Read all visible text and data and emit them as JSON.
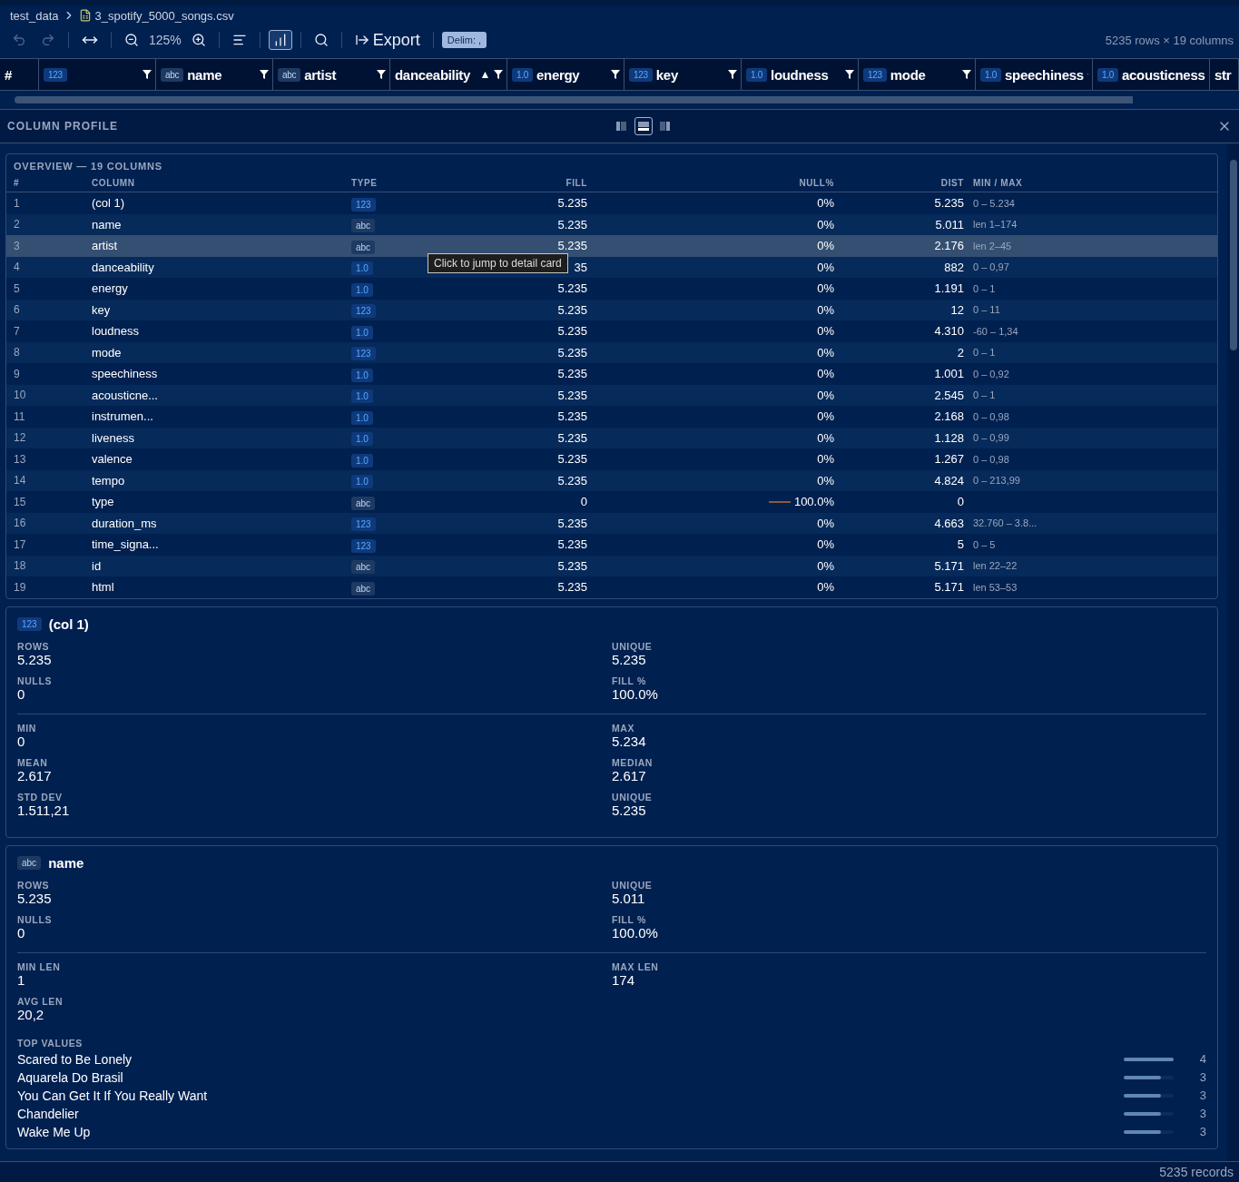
{
  "breadcrumb": {
    "folder": "test_data",
    "file": "3_spotify_5000_songs.csv"
  },
  "toolbar": {
    "undo_enabled": false,
    "redo_enabled": false,
    "zoom": "125%",
    "profile_active": true,
    "export_label": "Export",
    "delimiter": "Delim: ,",
    "summary": "5235 rows × 19 columns"
  },
  "grid_header": {
    "row_number": "#",
    "columns": [
      {
        "badge": "123",
        "kind": "integer"
      },
      {
        "badge": "abc",
        "kind": "text",
        "name": "name"
      },
      {
        "badge": "abc",
        "kind": "text",
        "name": "artist"
      },
      {
        "name": "danceability",
        "sort": "▲"
      },
      {
        "badge": "1.0",
        "kind": "float",
        "name": "energy"
      },
      {
        "badge": "123",
        "kind": "integer",
        "name": "key"
      },
      {
        "badge": "1.0",
        "kind": "float",
        "name": "loudness"
      },
      {
        "badge": "123",
        "kind": "integer",
        "name": "mode"
      },
      {
        "badge": "1.0",
        "kind": "float",
        "name": "speechiness"
      },
      {
        "badge": "1.0",
        "kind": "float",
        "name": "acousticness"
      },
      {
        "name": "str"
      }
    ]
  },
  "profile": {
    "title": "COLUMN PROFILE",
    "layouts": [
      {
        "selected": false
      },
      {
        "selected": true
      },
      {
        "selected": false
      }
    ],
    "overview": {
      "title": "OVERVIEW — 19 COLUMNS",
      "headers": [
        "#",
        "COLUMN",
        "TYPE",
        "FILL",
        "NULL%",
        "DIST",
        "MIN / MAX"
      ],
      "tooltip": "Click to jump to detail card",
      "rows": [
        {
          "n": "1",
          "column": "(col 1)",
          "badge": "123",
          "kind": "integer",
          "fill": "5.235",
          "null": "0%",
          "dist": "5.235",
          "range": "0 – 5.234",
          "selected": false
        },
        {
          "n": "2",
          "column": "name",
          "badge": "abc",
          "kind": "text",
          "fill": "5.235",
          "null": "0%",
          "dist": "5.011",
          "range": "len 1–174",
          "selected": false
        },
        {
          "n": "3",
          "column": "artist",
          "badge": "abc",
          "kind": "text",
          "fill": "5.235",
          "null": "0%",
          "dist": "2.176",
          "range": "len 2–45",
          "selected": true
        },
        {
          "n": "4",
          "column": "danceability",
          "badge": "1.0",
          "kind": "float",
          "fill": "35",
          "null": "0%",
          "dist": "882",
          "range": "0 – 0,97",
          "selected": false
        },
        {
          "n": "5",
          "column": "energy",
          "badge": "1.0",
          "kind": "float",
          "fill": "5.235",
          "null": "0%",
          "dist": "1.191",
          "range": "0 – 1",
          "selected": false
        },
        {
          "n": "6",
          "column": "key",
          "badge": "123",
          "kind": "integer",
          "fill": "5.235",
          "null": "0%",
          "dist": "12",
          "range": "0 – 11",
          "selected": false
        },
        {
          "n": "7",
          "column": "loudness",
          "badge": "1.0",
          "kind": "float",
          "fill": "5.235",
          "null": "0%",
          "dist": "4.310",
          "range": "-60 – 1,34",
          "selected": false
        },
        {
          "n": "8",
          "column": "mode",
          "badge": "123",
          "kind": "integer",
          "fill": "5.235",
          "null": "0%",
          "dist": "2",
          "range": "0 – 1",
          "selected": false
        },
        {
          "n": "9",
          "column": "speechiness",
          "badge": "1.0",
          "kind": "float",
          "fill": "5.235",
          "null": "0%",
          "dist": "1.001",
          "range": "0 – 0,92",
          "selected": false
        },
        {
          "n": "10",
          "column": "acousticne...",
          "badge": "1.0",
          "kind": "float",
          "fill": "5.235",
          "null": "0%",
          "dist": "2.545",
          "range": "0 – 1",
          "selected": false
        },
        {
          "n": "11",
          "column": "instrumen...",
          "badge": "1.0",
          "kind": "float",
          "fill": "5.235",
          "null": "0%",
          "dist": "2.168",
          "range": "0 – 0,98",
          "selected": false
        },
        {
          "n": "12",
          "column": "liveness",
          "badge": "1.0",
          "kind": "float",
          "fill": "5.235",
          "null": "0%",
          "dist": "1.128",
          "range": "0 – 0,99",
          "selected": false
        },
        {
          "n": "13",
          "column": "valence",
          "badge": "1.0",
          "kind": "float",
          "fill": "5.235",
          "null": "0%",
          "dist": "1.267",
          "range": "0 – 0,98",
          "selected": false
        },
        {
          "n": "14",
          "column": "tempo",
          "badge": "1.0",
          "kind": "float",
          "fill": "5.235",
          "null": "0%",
          "dist": "4.824",
          "range": "0 – 213,99",
          "selected": false
        },
        {
          "n": "15",
          "column": "type",
          "badge": "abc",
          "kind": "text",
          "fill": "0",
          "null": "100.0%",
          "null_bar": true,
          "dist": "0",
          "selected": false
        },
        {
          "n": "16",
          "column": "duration_ms",
          "badge": "123",
          "kind": "integer",
          "fill": "5.235",
          "null": "0%",
          "dist": "4.663",
          "range": "32.760 – 3.8...",
          "selected": false
        },
        {
          "n": "17",
          "column": "time_signa...",
          "badge": "123",
          "kind": "integer",
          "fill": "5.235",
          "null": "0%",
          "dist": "5",
          "range": "0 – 5",
          "selected": false
        },
        {
          "n": "18",
          "column": "id",
          "badge": "abc",
          "kind": "text",
          "fill": "5.235",
          "null": "0%",
          "dist": "5.171",
          "range": "len 22–22",
          "selected": false
        },
        {
          "n": "19",
          "column": "html",
          "badge": "abc",
          "kind": "text",
          "fill": "5.235",
          "null": "0%",
          "dist": "5.171",
          "range": "len 53–53",
          "selected": false
        }
      ]
    },
    "cards": [
      {
        "badge": "123",
        "kind": "integer",
        "name": "(col 1)",
        "sections": [
          [
            [
              {
                "label": "ROWS",
                "value": "5.235"
              },
              {
                "label": "UNIQUE",
                "value": "5.235"
              }
            ],
            [
              {
                "label": "NULLS",
                "value": "0"
              },
              {
                "label": "FILL %",
                "value": "100.0%"
              }
            ]
          ],
          [
            [
              {
                "label": "MIN",
                "value": "0"
              },
              {
                "label": "MAX",
                "value": "5.234"
              }
            ],
            [
              {
                "label": "MEAN",
                "value": "2.617"
              },
              {
                "label": "MEDIAN",
                "value": "2.617"
              }
            ],
            [
              {
                "label": "STD DEV",
                "value": "1.511,21"
              },
              {
                "label": "UNIQUE",
                "value": "5.235"
              }
            ]
          ]
        ]
      },
      {
        "badge": "abc",
        "kind": "text",
        "name": "name",
        "sections": [
          [
            [
              {
                "label": "ROWS",
                "value": "5.235"
              },
              {
                "label": "UNIQUE",
                "value": "5.011"
              }
            ],
            [
              {
                "label": "NULLS",
                "value": "0"
              },
              {
                "label": "FILL %",
                "value": "100.0%"
              }
            ]
          ],
          [
            [
              {
                "label": "MIN LEN",
                "value": "1"
              },
              {
                "label": "MAX LEN",
                "value": "174"
              }
            ],
            [
              {
                "label": "AVG LEN",
                "value": "20,2"
              }
            ]
          ]
        ],
        "top_values_label": "TOP VALUES",
        "top_values": [
          {
            "value": "Scared to Be Lonely",
            "count": "4",
            "level": 1
          },
          {
            "value": "Aquarela Do Brasil",
            "count": "3",
            "level": 0.75
          },
          {
            "value": "You Can Get It If You Really Want",
            "count": "3",
            "level": 0.75
          },
          {
            "value": "Chandelier",
            "count": "3",
            "level": 0.75
          },
          {
            "value": "Wake Me Up",
            "count": "3",
            "level": 0.75
          }
        ]
      }
    ]
  },
  "status_bar": {
    "records": "5235 records"
  }
}
